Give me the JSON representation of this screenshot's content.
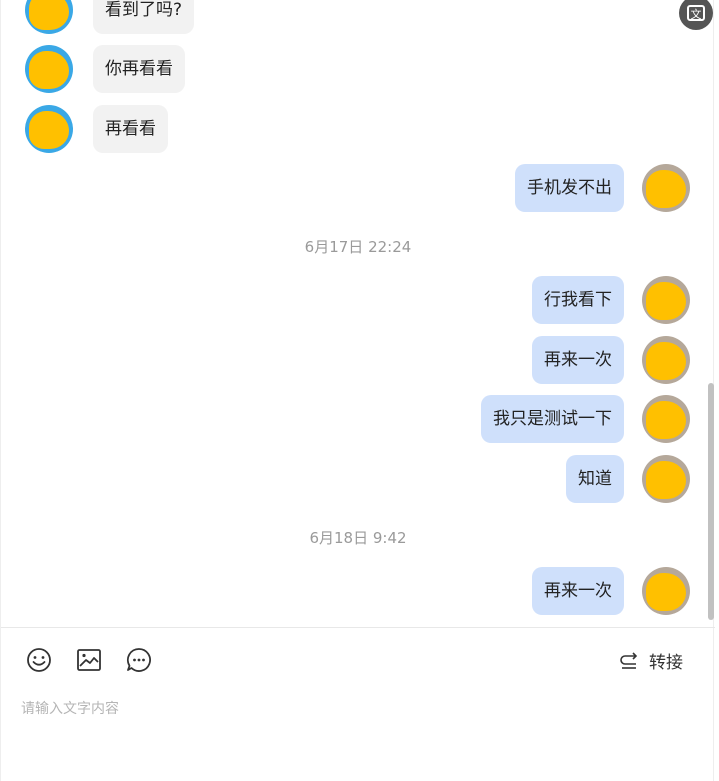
{
  "messages": [
    {
      "side": "left",
      "text": "看到了吗?",
      "avatar": "blue"
    },
    {
      "side": "left",
      "text": "你再看看",
      "avatar": "blue"
    },
    {
      "side": "left",
      "text": "再看看",
      "avatar": "blue"
    },
    {
      "side": "right",
      "text": "手机发不出",
      "avatar": "photo"
    },
    {
      "side": "time",
      "text": "6月17日 22:24"
    },
    {
      "side": "right",
      "text": "行我看下",
      "avatar": "photo"
    },
    {
      "side": "right",
      "text": "再来一次",
      "avatar": "photo"
    },
    {
      "side": "right",
      "text": "我只是测试一下",
      "avatar": "photo"
    },
    {
      "side": "right",
      "text": "知道",
      "avatar": "photo"
    },
    {
      "side": "time",
      "text": "6月18日 9:42"
    },
    {
      "side": "right",
      "text": "再来一次",
      "avatar": "photo"
    }
  ],
  "toolbar": {
    "icons": [
      "emoji-icon",
      "image-icon",
      "chat-bubble-icon"
    ],
    "transfer_label": "转接",
    "transfer_icon": "transfer-icon"
  },
  "input": {
    "placeholder": "请输入文字内容",
    "value": ""
  },
  "translate_icon": "translate-icon",
  "colors": {
    "sent_bubble": "#cfe0fb",
    "received_bubble": "#f2f2f2",
    "timestamp": "#9a9a9a",
    "avatar_blue": "#3aa8e6",
    "redaction": "#ffc000"
  }
}
